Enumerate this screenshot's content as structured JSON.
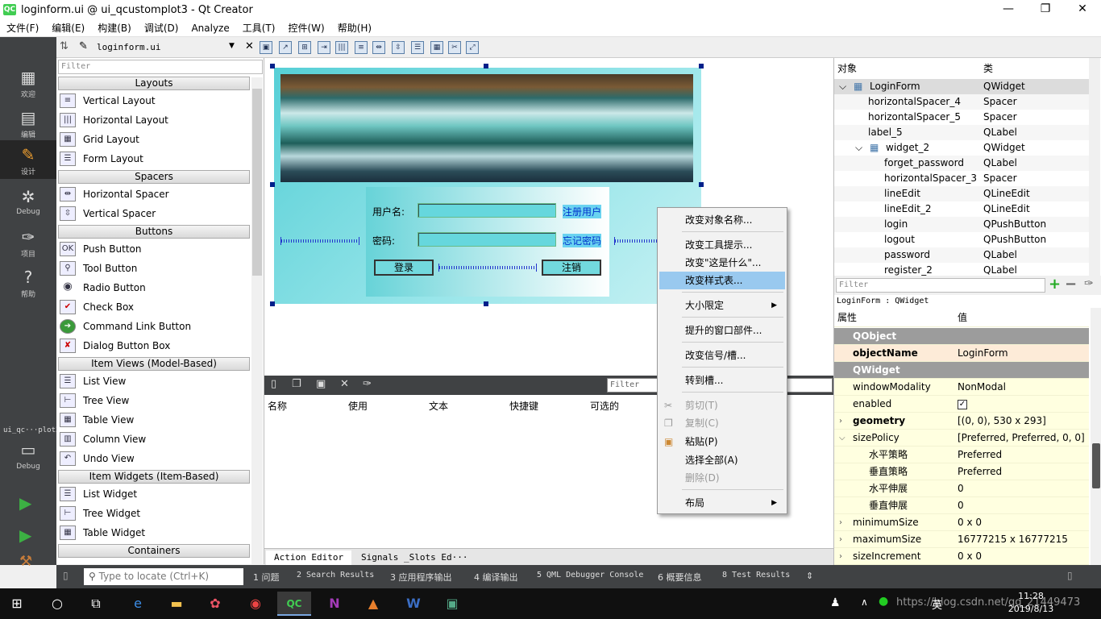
{
  "window": {
    "title": "loginform.ui @ ui_qcustomplot3 - Qt Creator",
    "logo": "QC",
    "minimize": "—",
    "maximize": "❐",
    "close": "✕"
  },
  "menubar": [
    "文件(F)",
    "编辑(E)",
    "构建(B)",
    "调试(D)",
    "Analyze",
    "工具(T)",
    "控件(W)",
    "帮助(H)"
  ],
  "modes": [
    {
      "label": "欢迎",
      "icon": "grid-icon"
    },
    {
      "label": "编辑",
      "icon": "document-icon"
    },
    {
      "label": "设计",
      "icon": "pencil-icon"
    },
    {
      "label": "Debug",
      "icon": "bug-icon"
    },
    {
      "label": "项目",
      "icon": "wrench-icon"
    },
    {
      "label": "帮助",
      "icon": "help-icon"
    }
  ],
  "kit": {
    "name": "ui_qc···plot3",
    "mode": "Debug"
  },
  "editor": {
    "file": "loginform.ui"
  },
  "widgetbox": {
    "filter": "Filter",
    "categories": {
      "layouts": "Layouts",
      "spacers": "Spacers",
      "buttons": "Buttons",
      "itemviews": "Item Views (Model-Based)",
      "itemwidgets": "Item Widgets (Item-Based)",
      "containers": "Containers"
    },
    "items": [
      "Vertical Layout",
      "Horizontal Layout",
      "Grid Layout",
      "Form Layout",
      "Horizontal Spacer",
      "Vertical Spacer",
      "Push Button",
      "Tool Button",
      "Radio Button",
      "Check Box",
      "Command Link Button",
      "Dialog Button Box",
      "List View",
      "Tree View",
      "Table View",
      "Column View",
      "Undo View",
      "List Widget",
      "Tree Widget",
      "Table Widget"
    ]
  },
  "form": {
    "username_label": "用户名:",
    "password_label": "密码:",
    "register_link": "注册用户",
    "forgot_link": "忘记密码",
    "login_button": "登录",
    "logout_button": "注销"
  },
  "action_editor": {
    "filter": "Filter",
    "columns": [
      "名称",
      "使用",
      "文本",
      "快捷键",
      "可选的"
    ],
    "tabs": [
      "Action Editor",
      "Signals _Slots Ed···"
    ]
  },
  "object_inspector": {
    "headers": [
      "对象",
      "类"
    ],
    "rows": [
      {
        "name": "LoginForm",
        "cls": "QWidget"
      },
      {
        "name": "horizontalSpacer_4",
        "cls": "Spacer"
      },
      {
        "name": "horizontalSpacer_5",
        "cls": "Spacer"
      },
      {
        "name": "label_5",
        "cls": "QLabel"
      },
      {
        "name": "widget_2",
        "cls": "QWidget"
      },
      {
        "name": "forget_password",
        "cls": "QLabel"
      },
      {
        "name": "horizontalSpacer_3",
        "cls": "Spacer"
      },
      {
        "name": "lineEdit",
        "cls": "QLineEdit"
      },
      {
        "name": "lineEdit_2",
        "cls": "QLineEdit"
      },
      {
        "name": "login",
        "cls": "QPushButton"
      },
      {
        "name": "logout",
        "cls": "QPushButton"
      },
      {
        "name": "password",
        "cls": "QLabel"
      },
      {
        "name": "register_2",
        "cls": "QLabel"
      }
    ]
  },
  "property_editor": {
    "filter": "Filter",
    "class_line": "LoginForm : QWidget",
    "headers": [
      "属性",
      "值"
    ],
    "rows": [
      {
        "name": "QObject",
        "value": ""
      },
      {
        "name": "objectName",
        "value": "LoginForm"
      },
      {
        "name": "QWidget",
        "value": ""
      },
      {
        "name": "windowModality",
        "value": "NonModal"
      },
      {
        "name": "enabled",
        "value": "✓"
      },
      {
        "name": "geometry",
        "value": "[(0, 0), 530 x 293]"
      },
      {
        "name": "sizePolicy",
        "value": "[Preferred, Preferred, 0, 0]"
      },
      {
        "name": "水平策略",
        "value": "Preferred"
      },
      {
        "name": "垂直策略",
        "value": "Preferred"
      },
      {
        "name": "水平伸展",
        "value": "0"
      },
      {
        "name": "垂直伸展",
        "value": "0"
      },
      {
        "name": "minimumSize",
        "value": "0 x 0"
      },
      {
        "name": "maximumSize",
        "value": "16777215 x 16777215"
      },
      {
        "name": "sizeIncrement",
        "value": "0 x 0"
      }
    ]
  },
  "context_menu": {
    "items": [
      "改变对象名称...",
      "改变工具提示...",
      "改变\"这是什么\"...",
      "改变样式表...",
      "大小限定",
      "提升的窗口部件...",
      "改变信号/槽...",
      "转到槽...",
      "剪切(T)",
      "复制(C)",
      "粘贴(P)",
      "选择全部(A)",
      "删除(D)",
      "布局"
    ],
    "highlighted": "改变样式表..."
  },
  "outputbar": {
    "locate_placeholder": "Type to locate (Ctrl+K)",
    "tabs": [
      "1 问题",
      "2 Search Results",
      "3 应用程序输出",
      "4 编译输出",
      "5 QML Debugger Console",
      "6 概要信息",
      "8 Test Results"
    ]
  },
  "taskbar": {
    "time": "11:28",
    "date": "2019/8/13",
    "ime": "英",
    "watermark": "https://blog.csdn.net/qq_21449473"
  }
}
